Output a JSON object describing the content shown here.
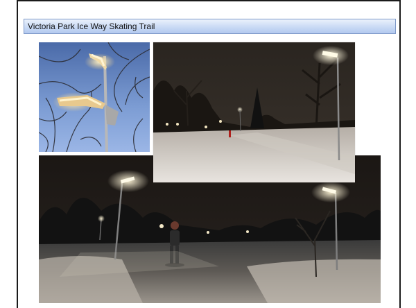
{
  "slide": {
    "title": "Victoria Park Ice Way Skating Trail"
  },
  "photos": [
    {
      "id": "photo-topleft",
      "subject": "LED street lamp heads against twilight sky"
    },
    {
      "id": "photo-topright",
      "subject": "lit snowy path at night"
    },
    {
      "id": "photo-bottom",
      "subject": "skater on illuminated ice trail at night"
    }
  ],
  "colors": {
    "title_bar_top": "#eaf1fb",
    "title_bar_bottom": "#b3c9ef",
    "title_bar_border": "#7d98c8",
    "frame": "#1a1a1a"
  }
}
